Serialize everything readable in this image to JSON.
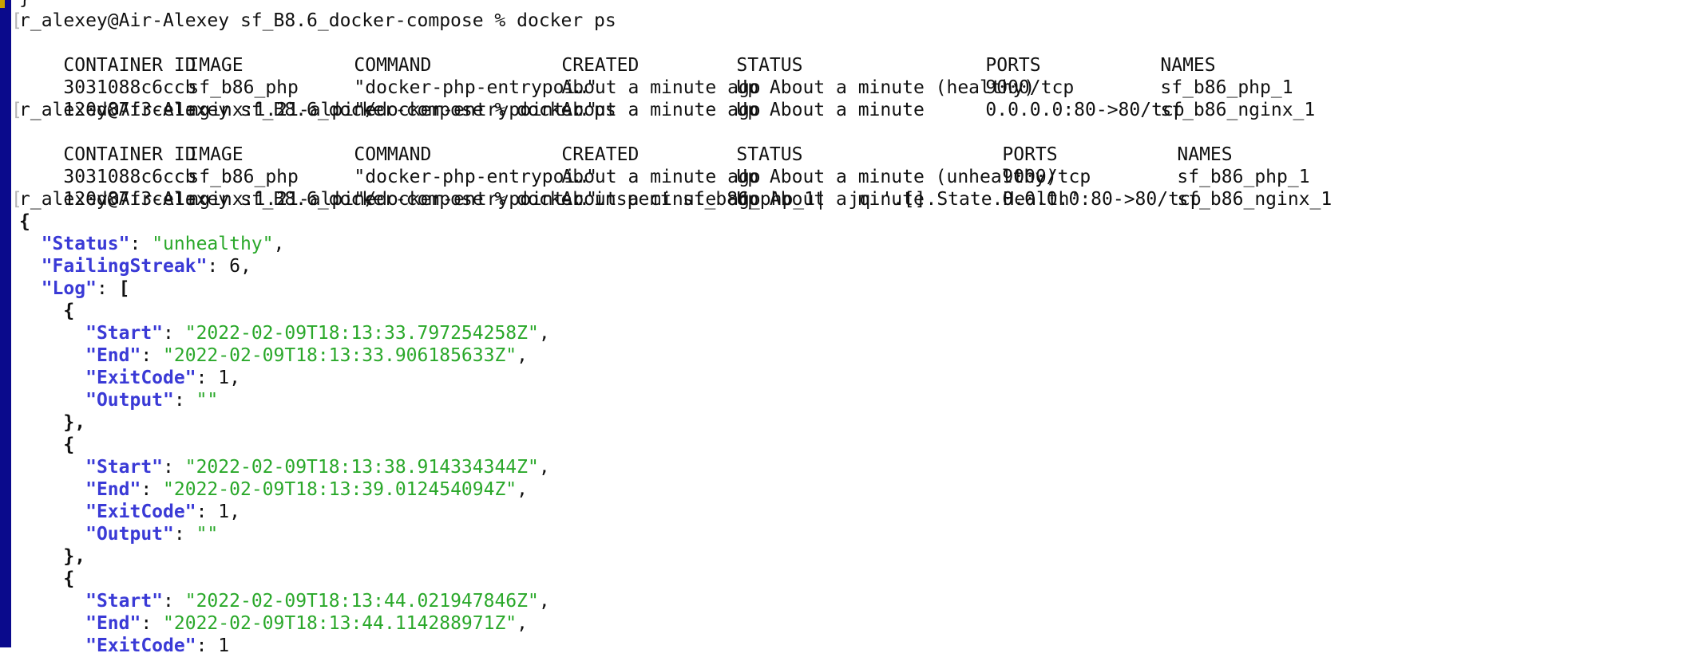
{
  "terminal": {
    "top_fragment": "}",
    "prompt1": "r_alexey@Air-Alexey sf_B8.6_docker-compose % docker ps",
    "prompt2": "r_alexey@Air-Alexey sf_B8.6_docker-compose % docker ps",
    "prompt3": "r_alexey@Air-Alexey sf_B8.6_docker-compose % docker inspect sf_b86_php_1|  jq '.[].State.Health'"
  },
  "ps1": {
    "headers": [
      "CONTAINER ID",
      "IMAGE",
      "COMMAND",
      "CREATED",
      "STATUS",
      "PORTS",
      "NAMES"
    ],
    "rows": [
      [
        "3031088c6ccb",
        "sf_b86_php",
        "\"docker-php-entrypoi…\"",
        "About a minute ago",
        "Up About a minute (healthy)",
        "9000/tcp",
        "sf_b86_php_1"
      ],
      [
        "120d87f3ce1a",
        "nginx:1.21-alpine",
        "\"/docker-entrypoint.…\"",
        "About a minute ago",
        "Up About a minute",
        "0.0.0.0:80->80/tcp",
        "sf_b86_nginx_1"
      ]
    ]
  },
  "ps2": {
    "headers": [
      "CONTAINER ID",
      "IMAGE",
      "COMMAND",
      "CREATED",
      "STATUS",
      "PORTS",
      "NAMES"
    ],
    "rows": [
      [
        "3031088c6ccb",
        "sf_b86_php",
        "\"docker-php-entrypoi…\"",
        "About a minute ago",
        "Up About a minute (unhealthy)",
        "9000/tcp",
        "sf_b86_php_1"
      ],
      [
        "120d87f3ce1a",
        "nginx:1.21-alpine",
        "\"/docker-entrypoint.…\"",
        "About a minute ago",
        "Up About a minute",
        "0.0.0.0:80->80/tcp",
        "sf_b86_nginx_1"
      ]
    ]
  },
  "json": {
    "open_brace": "{",
    "status_key": "\"Status\"",
    "status_val": "\"unhealthy\"",
    "streak_key": "\"FailingStreak\"",
    "streak_val": "6",
    "log_key": "\"Log\"",
    "open_bracket": "[",
    "entries": [
      {
        "start_key": "\"Start\"",
        "start_val": "\"2022-02-09T18:13:33.797254258Z\"",
        "end_key": "\"End\"",
        "end_val": "\"2022-02-09T18:13:33.906185633Z\"",
        "exit_key": "\"ExitCode\"",
        "exit_val": "1",
        "output_key": "\"Output\"",
        "output_val": "\"\""
      },
      {
        "start_key": "\"Start\"",
        "start_val": "\"2022-02-09T18:13:38.914334344Z\"",
        "end_key": "\"End\"",
        "end_val": "\"2022-02-09T18:13:39.012454094Z\"",
        "exit_key": "\"ExitCode\"",
        "exit_val": "1",
        "output_key": "\"Output\"",
        "output_val": "\"\""
      },
      {
        "start_key": "\"Start\"",
        "start_val": "\"2022-02-09T18:13:44.021947846Z\"",
        "end_key": "\"End\"",
        "end_val": "\"2022-02-09T18:13:44.114288971Z\"",
        "exit_key": "\"ExitCode\"",
        "exit_val": "1"
      }
    ]
  }
}
